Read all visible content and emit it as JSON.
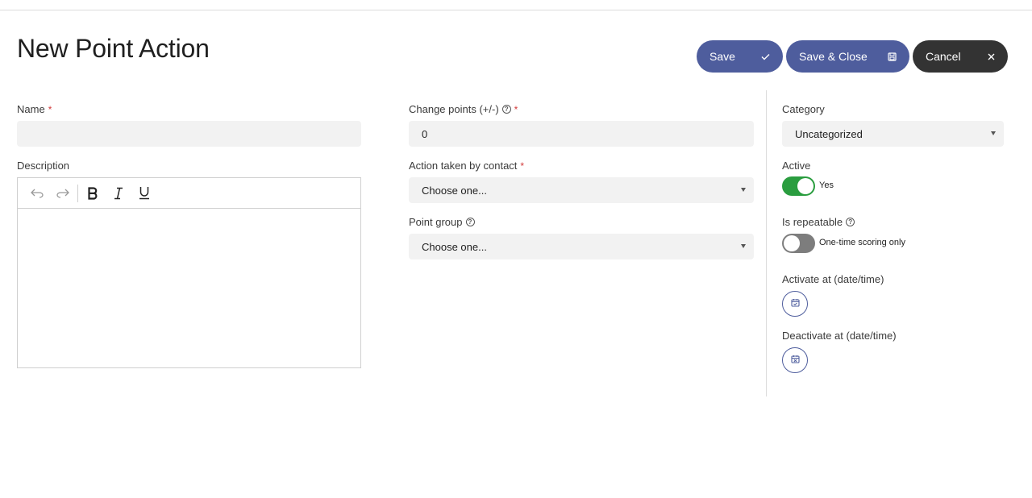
{
  "page": {
    "title": "New Point Action"
  },
  "toolbar": {
    "save_label": "Save",
    "save_close_label": "Save & Close",
    "cancel_label": "Cancel"
  },
  "form": {
    "name": {
      "label": "Name",
      "required_mark": "*",
      "value": ""
    },
    "description": {
      "label": "Description"
    },
    "change_points": {
      "label": "Change points (+/-)",
      "help": "?",
      "required_mark": "*",
      "value": "0"
    },
    "action_taken": {
      "label": "Action taken by contact",
      "required_mark": "*",
      "value": "Choose one..."
    },
    "point_group": {
      "label": "Point group",
      "help": "?",
      "value": "Choose one..."
    },
    "category": {
      "label": "Category",
      "value": "Uncategorized"
    },
    "active": {
      "label": "Active",
      "state": true,
      "state_text": "Yes"
    },
    "is_repeatable": {
      "label": "Is repeatable",
      "help": "?",
      "state": false,
      "state_text": "One-time scoring only"
    },
    "activate_at": {
      "label": "Activate at (date/time)"
    },
    "deactivate_at": {
      "label": "Deactivate at (date/time)"
    }
  },
  "colors": {
    "primary": "#4e5d9d",
    "dark": "#333333",
    "toggle_on": "#2a9d3f",
    "toggle_off": "#7d7d7d",
    "required": "#d23a3a"
  },
  "icons": {
    "save": "check-icon",
    "save_close": "floppy-disk-icon",
    "cancel": "close-icon",
    "undo": "undo-icon",
    "redo": "redo-icon",
    "bold": "bold-icon",
    "italic": "italic-icon",
    "underline": "underline-icon",
    "calendar": "calendar-icon",
    "help": "help-circle-icon",
    "select": "caret-down-icon"
  }
}
